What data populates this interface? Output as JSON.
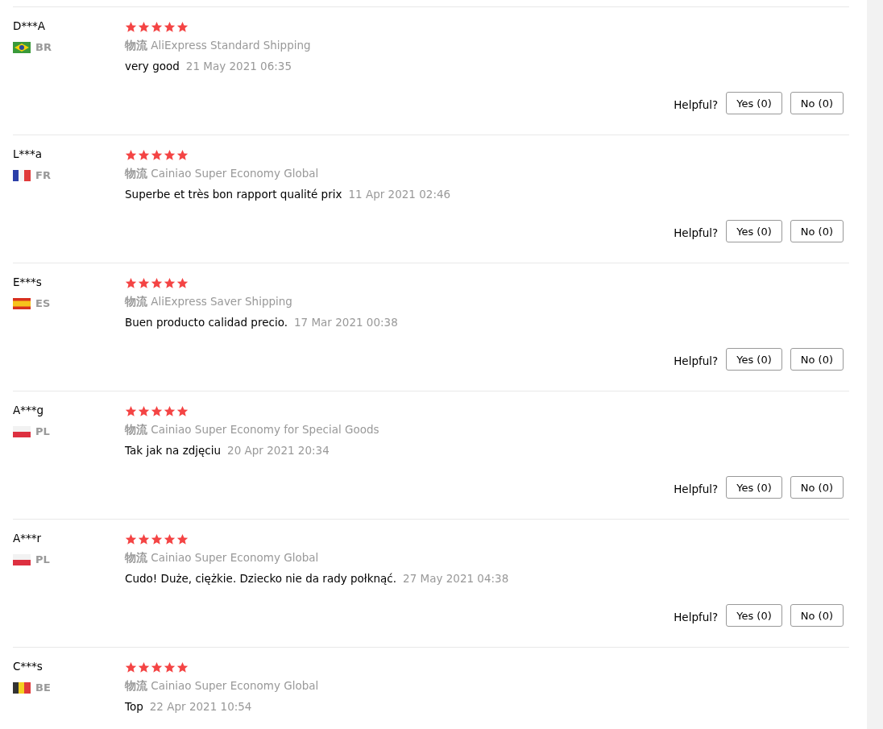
{
  "reviews": [
    {
      "name": "D***A",
      "kind": "br",
      "country": "BR",
      "stars": 5,
      "logistics_label": "物流",
      "shipping": "AliExpress Standard Shipping",
      "comment": "very good",
      "date": "21 May 2021 06:35",
      "helpful": "Helpful?",
      "yes": "Yes (0)",
      "no": "No (0)"
    },
    {
      "name": "L***a",
      "kind": "fr",
      "country": "FR",
      "stars": 5,
      "logistics_label": "物流",
      "shipping": "Cainiao Super Economy Global",
      "comment": "Superbe et très bon rapport qualité prix",
      "date": "11 Apr 2021 02:46",
      "helpful": "Helpful?",
      "yes": "Yes (0)",
      "no": "No (0)"
    },
    {
      "name": "E***s",
      "kind": "es",
      "country": "ES",
      "stars": 5,
      "logistics_label": "物流",
      "shipping": "AliExpress Saver Shipping",
      "comment": "Buen producto calidad precio.",
      "date": "17 Mar 2021 00:38",
      "helpful": "Helpful?",
      "yes": "Yes (0)",
      "no": "No (0)"
    },
    {
      "name": "A***g",
      "kind": "pl",
      "country": "PL",
      "stars": 5,
      "logistics_label": "物流",
      "shipping": "Cainiao Super Economy for Special Goods",
      "comment": "Tak jak na zdjęciu",
      "date": "20 Apr 2021 20:34",
      "helpful": "Helpful?",
      "yes": "Yes (0)",
      "no": "No (0)"
    },
    {
      "name": "A***r",
      "kind": "pl",
      "country": "PL",
      "stars": 5,
      "logistics_label": "物流",
      "shipping": "Cainiao Super Economy Global",
      "comment": "Cudo! Duże, ciężkie. Dziecko nie da rady połknąć.",
      "date": "27 May 2021 04:38",
      "helpful": "Helpful?",
      "yes": "Yes (0)",
      "no": "No (0)"
    },
    {
      "name": "C***s",
      "kind": "be",
      "country": "BE",
      "stars": 5,
      "logistics_label": "物流",
      "shipping": "Cainiao Super Economy Global",
      "comment": "Top",
      "date": "22 Apr 2021 10:54"
    }
  ]
}
